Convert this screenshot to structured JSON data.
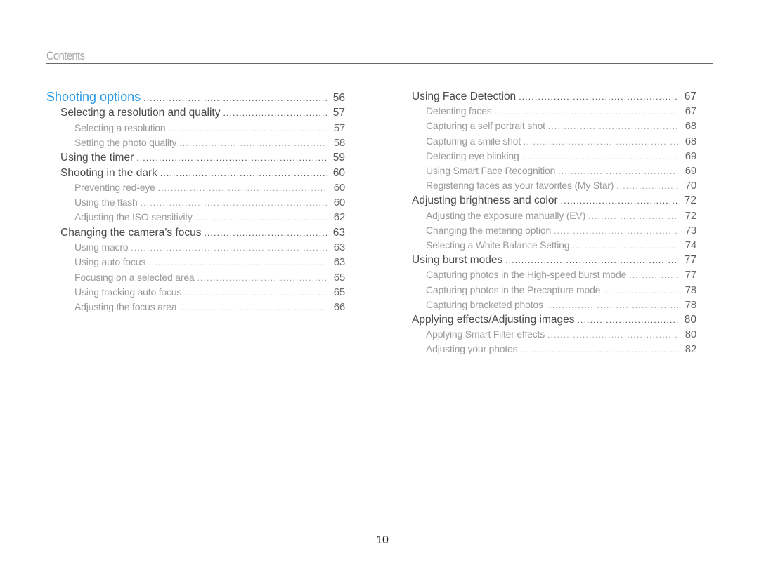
{
  "header": {
    "title": "Contents"
  },
  "left_column": [
    {
      "level": 0,
      "label": "Shooting options",
      "page": "56"
    },
    {
      "level": 1,
      "label": "Selecting a resolution and quality",
      "page": "57"
    },
    {
      "level": 2,
      "label": "Selecting a resolution",
      "page": "57"
    },
    {
      "level": 2,
      "label": "Setting the photo quality",
      "page": "58"
    },
    {
      "level": 1,
      "label": "Using the timer",
      "page": "59"
    },
    {
      "level": 1,
      "label": "Shooting in the dark",
      "page": "60"
    },
    {
      "level": 2,
      "label": "Preventing red-eye",
      "page": "60"
    },
    {
      "level": 2,
      "label": "Using the flash",
      "page": "60"
    },
    {
      "level": 2,
      "label": "Adjusting the ISO sensitivity",
      "page": "62"
    },
    {
      "level": 1,
      "label": "Changing the camera’s focus",
      "page": "63"
    },
    {
      "level": 2,
      "label": "Using macro",
      "page": "63"
    },
    {
      "level": 2,
      "label": "Using auto focus",
      "page": "63"
    },
    {
      "level": 2,
      "label": "Focusing on a selected area",
      "page": "65"
    },
    {
      "level": 2,
      "label": "Using tracking auto focus",
      "page": "65"
    },
    {
      "level": 2,
      "label": "Adjusting the focus area",
      "page": "66"
    }
  ],
  "right_column": [
    {
      "level": 1,
      "label": "Using Face Detection",
      "page": "67"
    },
    {
      "level": 2,
      "label": "Detecting faces",
      "page": "67"
    },
    {
      "level": 2,
      "label": "Capturing a self portrait shot",
      "page": "68"
    },
    {
      "level": 2,
      "label": "Capturing a smile shot",
      "page": "68"
    },
    {
      "level": 2,
      "label": "Detecting eye blinking",
      "page": "69"
    },
    {
      "level": 2,
      "label": "Using Smart Face Recognition",
      "page": "69"
    },
    {
      "level": 2,
      "label": "Registering faces as your favorites (My Star)",
      "page": "70"
    },
    {
      "level": 1,
      "label": "Adjusting brightness and color",
      "page": "72"
    },
    {
      "level": 2,
      "label": "Adjusting the exposure manually (EV)",
      "page": "72"
    },
    {
      "level": 2,
      "label": "Changing the metering option",
      "page": "73"
    },
    {
      "level": 2,
      "label": "Selecting a White Balance Setting",
      "page": "74"
    },
    {
      "level": 1,
      "label": "Using burst modes",
      "page": "77"
    },
    {
      "level": 2,
      "label": "Capturing photos in the High-speed burst mode",
      "page": "77"
    },
    {
      "level": 2,
      "label": "Capturing photos in the Precapture mode",
      "page": "78"
    },
    {
      "level": 2,
      "label": "Capturing bracketed photos",
      "page": "78"
    },
    {
      "level": 1,
      "label": "Applying effects/Adjusting images",
      "page": "80"
    },
    {
      "level": 2,
      "label": "Applying Smart Filter effects",
      "page": "80"
    },
    {
      "level": 2,
      "label": "Adjusting your photos",
      "page": "82"
    }
  ],
  "footer": {
    "page_number": "10"
  },
  "colors": {
    "section_accent": "#2b9be6",
    "heading_text": "#4a4a4a",
    "subitem_text": "#9a9a9a",
    "rule": "#6a6a6a"
  }
}
